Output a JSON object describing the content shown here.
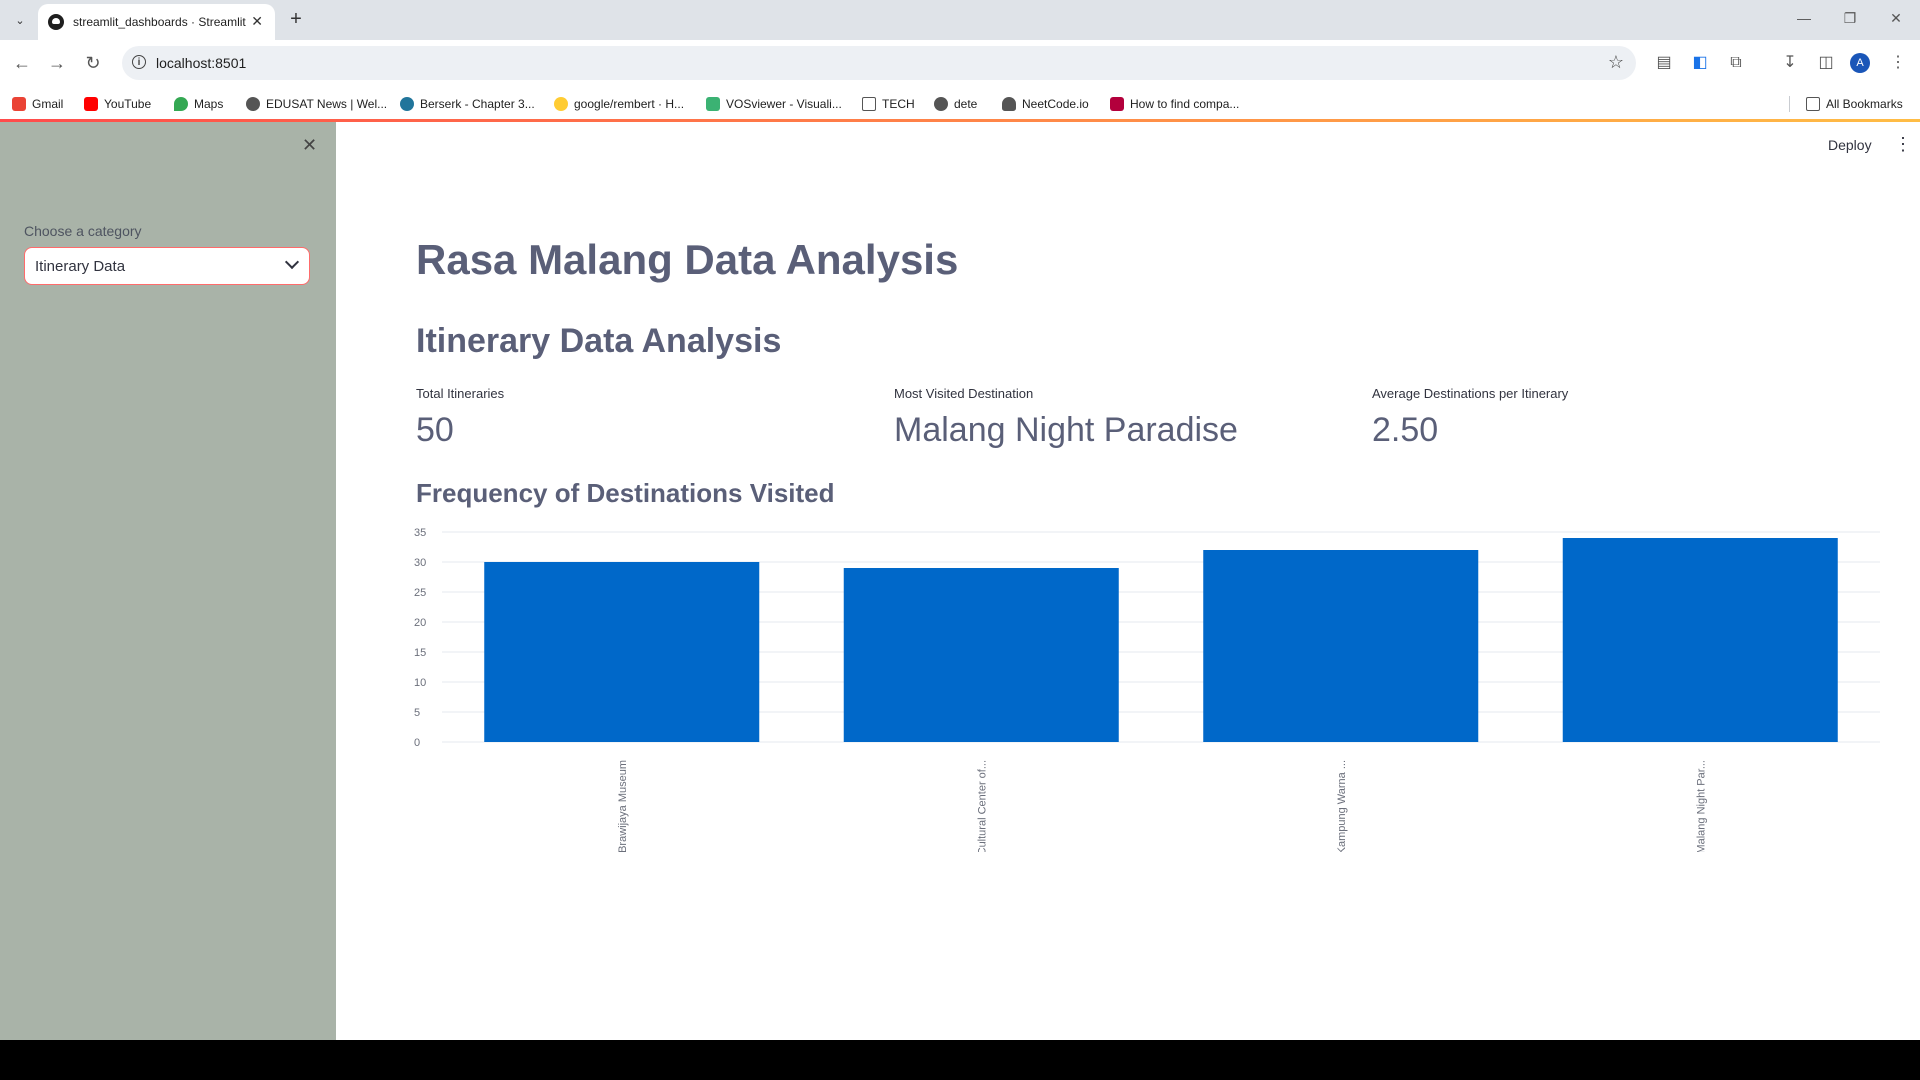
{
  "browser": {
    "tab_title": "streamlit_dashboards · Streamlit",
    "url": "localhost:8501",
    "bookmarks": [
      {
        "label": "Gmail",
        "color": "#ea4335"
      },
      {
        "label": "YouTube",
        "color": "#ff0000"
      },
      {
        "label": "Maps",
        "color": "#34a853"
      },
      {
        "label": "EDUSAT News | Wel...",
        "color": "#555555"
      },
      {
        "label": "Berserk - Chapter 3...",
        "color": "#21759b"
      },
      {
        "label": "google/rembert · H...",
        "color": "#ffcc33"
      },
      {
        "label": "VOSviewer - Visuali...",
        "color": "#3bb273"
      },
      {
        "label": "TECH",
        "color": "#555555"
      },
      {
        "label": "dete",
        "color": "#555555"
      },
      {
        "label": "NeetCode.io",
        "color": "#555555"
      },
      {
        "label": "How to find compa...",
        "color": "#b3003c"
      }
    ],
    "all_bookmarks": "All Bookmarks",
    "profile_initial": "A"
  },
  "sidebar": {
    "select_label": "Choose a category",
    "select_value": "Itinerary Data"
  },
  "header": {
    "deploy": "Deploy"
  },
  "main": {
    "title": "Rasa Malang Data Analysis",
    "subtitle": "Itinerary Data Analysis",
    "metrics": [
      {
        "label": "Total Itineraries",
        "value": "50"
      },
      {
        "label": "Most Visited Destination",
        "value": "Malang Night Paradise"
      },
      {
        "label": "Average Destinations per Itinerary",
        "value": "2.50"
      }
    ],
    "chart_title": "Frequency of Destinations Visited"
  },
  "chart_data": {
    "type": "bar",
    "title": "Frequency of Destinations Visited",
    "categories": [
      "Brawijaya Museum",
      "Cultural Center of...",
      "Kampung Warna ...",
      "Malang Night Par..."
    ],
    "values": [
      30,
      29,
      32,
      34
    ],
    "ylim": [
      0,
      35
    ],
    "yticks": [
      0,
      5,
      10,
      15,
      20,
      25,
      30,
      35
    ],
    "bar_color": "#0068c9",
    "grid": true
  }
}
